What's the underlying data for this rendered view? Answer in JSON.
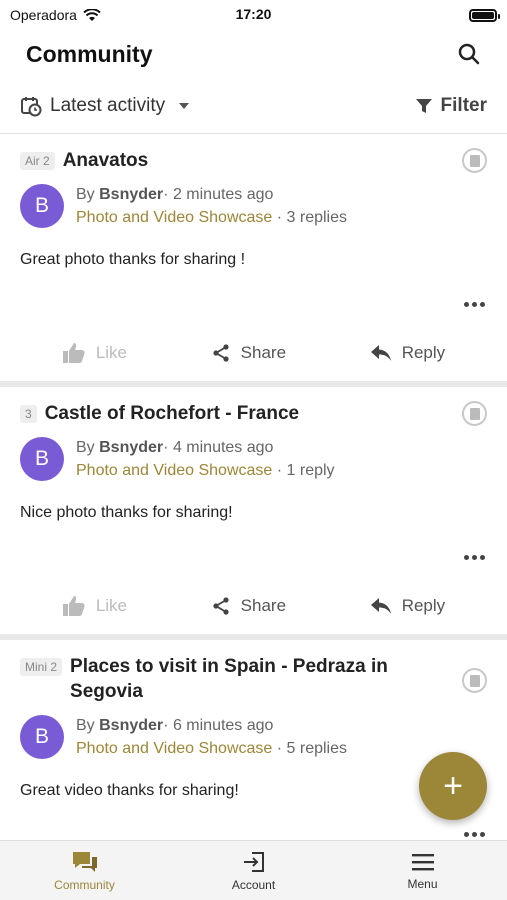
{
  "status": {
    "carrier": "Operadora",
    "time": "17:20"
  },
  "header": {
    "title": "Community"
  },
  "toolbar": {
    "sort_label": "Latest activity",
    "filter_label": "Filter"
  },
  "posts": [
    {
      "tag": "Air 2",
      "title": "Anavatos",
      "avatar": "B",
      "by": "By",
      "author": "Bsnyder",
      "time": "2 minutes ago",
      "forum": "Photo and Video Showcase",
      "replies": "3 replies",
      "body": "Great photo thanks for sharing !"
    },
    {
      "tag": "3",
      "title": "Castle of Rochefort - France",
      "avatar": "B",
      "by": "By",
      "author": "Bsnyder",
      "time": "4 minutes ago",
      "forum": "Photo and Video Showcase",
      "replies": "1 reply",
      "body": "Nice photo thanks for sharing!"
    },
    {
      "tag": "Mini 2",
      "title": "Places to visit in Spain - Pedraza in Segovia",
      "avatar": "B",
      "by": "By",
      "author": "Bsnyder",
      "time": "6 minutes ago",
      "forum": "Photo and Video Showcase",
      "replies": "5 replies",
      "body": "Great video thanks for sharing!"
    }
  ],
  "actions": {
    "like": "Like",
    "share": "Share",
    "reply": "Reply"
  },
  "fab": {
    "label": "+"
  },
  "tabs": [
    {
      "label": "Community",
      "icon": "chat-bubbles-icon"
    },
    {
      "label": "Account",
      "icon": "sign-in-icon"
    },
    {
      "label": "Menu",
      "icon": "hamburger-icon"
    }
  ],
  "colors": {
    "accent": "#9c8638",
    "avatar": "#7a5bd6"
  }
}
